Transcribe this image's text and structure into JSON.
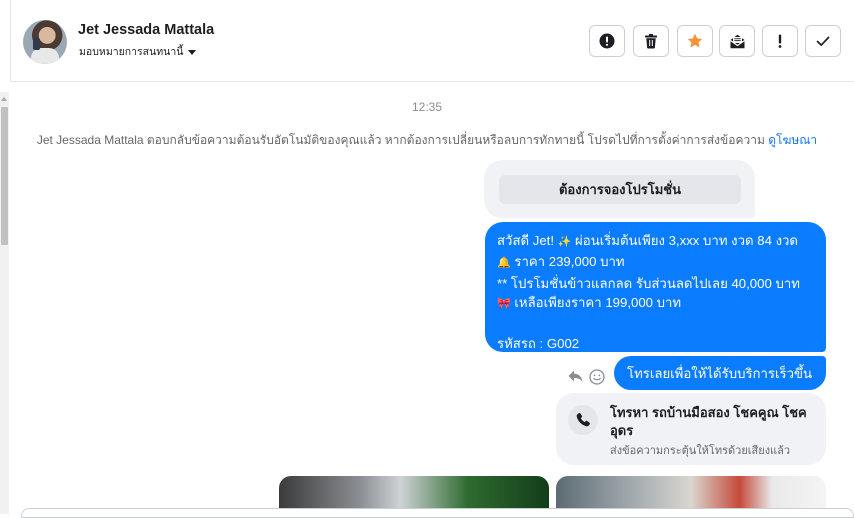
{
  "header": {
    "contact_name": "Jet Jessada Mattala",
    "assign_label": "มอบหมายการสนทนานี้",
    "toolbar": [
      {
        "icon": "alert-circle-icon",
        "color": "#1c1e21"
      },
      {
        "icon": "trash-icon",
        "color": "#1c1e21"
      },
      {
        "icon": "star-icon",
        "color": "#f7923a"
      },
      {
        "icon": "mail-read-icon",
        "color": "#1c1e21"
      },
      {
        "icon": "exclamation-icon",
        "color": "#1c1e21"
      },
      {
        "icon": "check-icon",
        "color": "#1c1e21"
      }
    ]
  },
  "conversation": {
    "timestamp": "12:35",
    "notice_text": "Jet Jessada Mattala ตอบกลับข้อความต้อนรับอัตโนมัติของคุณแล้ว หากต้องการเปลี่ยนหรือลบการทักทายนี้ โปรดไปที่การตั้งค่าการส่งข้อความ",
    "notice_link": "ดูโฆษณา",
    "quick_reply_button": "ต้องการจองโปรโมชั่น",
    "message_1": {
      "line1": "สวัสดี Jet!",
      "line1_emoji": "✨",
      "line1_rest": " ผ่อนเริ่มต้นเพียง 3,xxx บาท งวด 84 งวด",
      "line2_emoji": "🔔",
      "line2_rest": " ราคา 239,000 บาท",
      "line3": "** โปรโมชั่นข้าวแลกลด รับส่วนลดไปเลย 40,000 บาท",
      "line4_emoji": "🎀",
      "line4_rest": "  เหลือเพียงราคา 199,000 บาท",
      "line6": "รหัสรถ : G002"
    },
    "message_2": "โทรเลยเพื่อให้ได้รับบริการเร็วขึ้น",
    "call_card": {
      "title": "โทรหา รถบ้านมือสอง โชคคูณ โชคอุดร",
      "subtitle": "ส่งข้อความกระตุ้นให้โทรด้วยเสียงแล้ว"
    }
  },
  "colors": {
    "accent_blue": "#0a7cff",
    "link_blue": "#1877f2",
    "bubble_gray": "#f0f2f5"
  }
}
